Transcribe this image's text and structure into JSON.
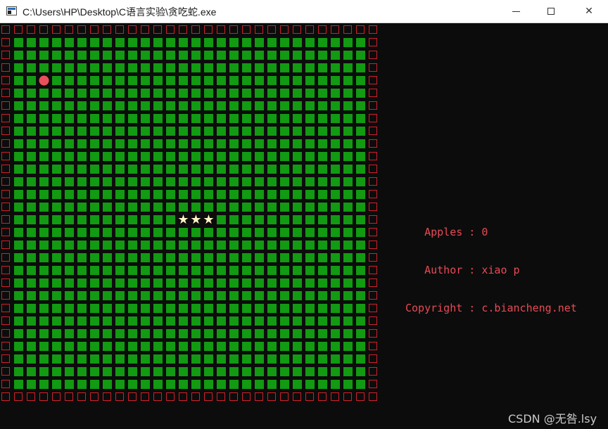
{
  "window": {
    "title": "C:\\Users\\HP\\Desktop\\C语言实验\\贪吃蛇.exe",
    "buttons": {
      "close_glyph": "✕"
    }
  },
  "game": {
    "grid_cols": 30,
    "grid_rows": 30,
    "colors": {
      "background": "#0c0c0c",
      "wall": "#d0202a",
      "floor": "#129a12",
      "apple": "#e8505b",
      "snake": "#fff3c6",
      "info_text": "#e84a55"
    },
    "snake": {
      "segments": [
        [
          14,
          15
        ],
        [
          15,
          15
        ],
        [
          16,
          15
        ]
      ],
      "glyph": "★"
    },
    "apple": {
      "cell": [
        3,
        4
      ]
    }
  },
  "info": {
    "apples_label": "Apples",
    "apples_value": "0",
    "author_label": "Author",
    "author_value": "xiao p",
    "copyright_label": "Copyright",
    "copyright_value": "c.biancheng.net"
  },
  "watermark": "CSDN @无咎.lsy"
}
